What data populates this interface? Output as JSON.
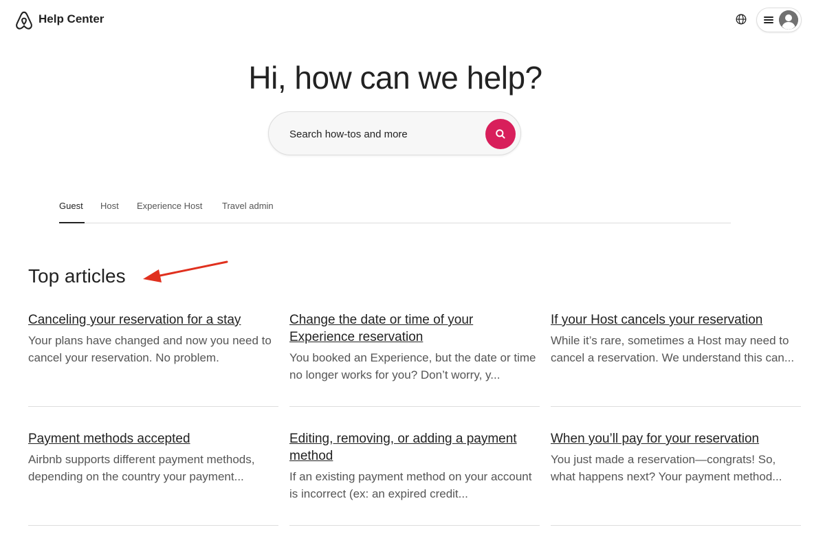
{
  "header": {
    "brand": "Help Center",
    "logo_icon": "airbnb-logo-icon",
    "globe_icon": "globe-icon",
    "menu_icon": "hamburger-menu-icon",
    "avatar_icon": "user-avatar-icon"
  },
  "hero": {
    "title": "Hi, how can we help?",
    "search_placeholder": "Search how-tos and more",
    "search_icon": "search-icon",
    "search_color": "#d81f5b"
  },
  "tabs": [
    {
      "label": "Guest",
      "active": true
    },
    {
      "label": "Host",
      "active": false
    },
    {
      "label": "Experience Host",
      "active": false
    },
    {
      "label": "Travel admin",
      "active": false
    }
  ],
  "top_articles": {
    "title": "Top articles",
    "annotation_icon": "red-arrow-icon",
    "annotation_color": "#e0301e",
    "articles": [
      {
        "title": "Canceling your reservation for a stay",
        "description": "Your plans have changed and now you need to cancel your reservation. No problem."
      },
      {
        "title": "Change the date or time of your Experience reservation",
        "description": "You booked an Experience, but the date or time no longer works for you? Don’t worry, y..."
      },
      {
        "title": "If your Host cancels your reservation",
        "description": "While it’s rare, sometimes a Host may need to cancel a reservation. We understand this can..."
      },
      {
        "title": "Payment methods accepted",
        "description": "Airbnb supports different payment methods, depending on the country your payment..."
      },
      {
        "title": "Editing, removing, or adding a payment method",
        "description": "If an existing payment method on your account is incorrect (ex: an expired credit..."
      },
      {
        "title": "When you’ll pay for your reservation",
        "description": "You just made a reservation—congrats! So, what happens next? Your payment method..."
      }
    ]
  }
}
